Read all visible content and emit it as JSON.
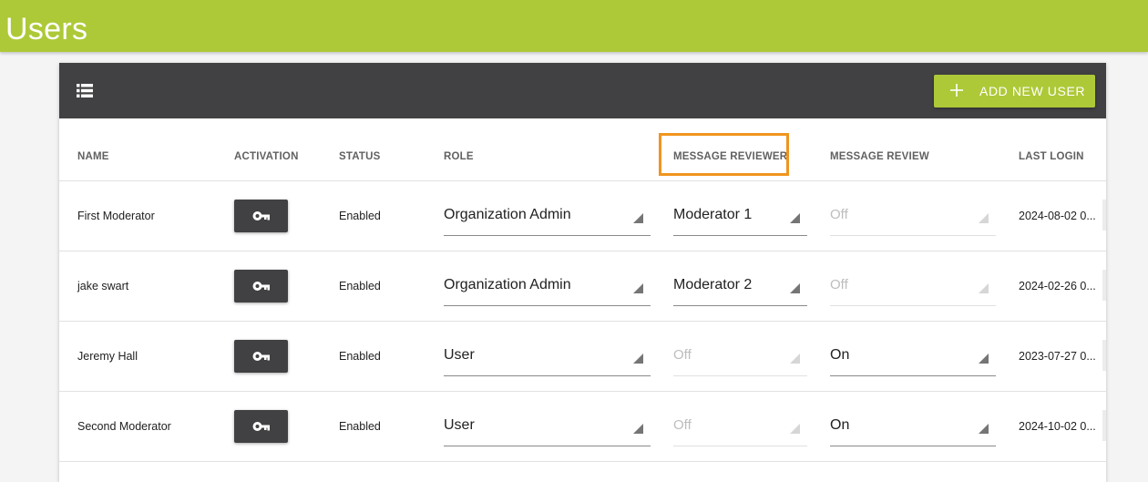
{
  "app": {
    "title": "Users",
    "accent": "#adc938",
    "toolbar_color": "#414143",
    "highlight_color": "#f0951e"
  },
  "toolbar": {
    "list_icon": "list-icon",
    "add_button_label": "ADD NEW USER",
    "add_icon": "plus-icon"
  },
  "table": {
    "headers": {
      "name": "NAME",
      "activation": "ACTIVATION",
      "status": "STATUS",
      "role": "ROLE",
      "message_reviewer": "MESSAGE REVIEWER",
      "message_review": "MESSAGE REVIEW",
      "last_login": "LAST LOGIN"
    },
    "rows": [
      {
        "name": "First Moderator",
        "activation_icon": "key-icon",
        "status": "Enabled",
        "role": "Organization Admin",
        "message_reviewer": "Moderator 1",
        "message_reviewer_disabled": false,
        "message_review": "Off",
        "message_review_disabled": true,
        "last_login": "2024-08-02 0..."
      },
      {
        "name": "jake swart",
        "activation_icon": "key-icon",
        "status": "Enabled",
        "role": "Organization Admin",
        "message_reviewer": "Moderator 2",
        "message_reviewer_disabled": false,
        "message_review": "Off",
        "message_review_disabled": true,
        "last_login": "2024-02-26 0..."
      },
      {
        "name": "Jeremy Hall",
        "activation_icon": "key-icon",
        "status": "Enabled",
        "role": "User",
        "message_reviewer": "Off",
        "message_reviewer_disabled": true,
        "message_review": "On",
        "message_review_disabled": false,
        "last_login": "2023-07-27 0..."
      },
      {
        "name": "Second Moderator",
        "activation_icon": "key-icon",
        "status": "Enabled",
        "role": "User",
        "message_reviewer": "Off",
        "message_reviewer_disabled": true,
        "message_review": "On",
        "message_review_disabled": false,
        "last_login": "2024-10-02 0..."
      }
    ]
  }
}
